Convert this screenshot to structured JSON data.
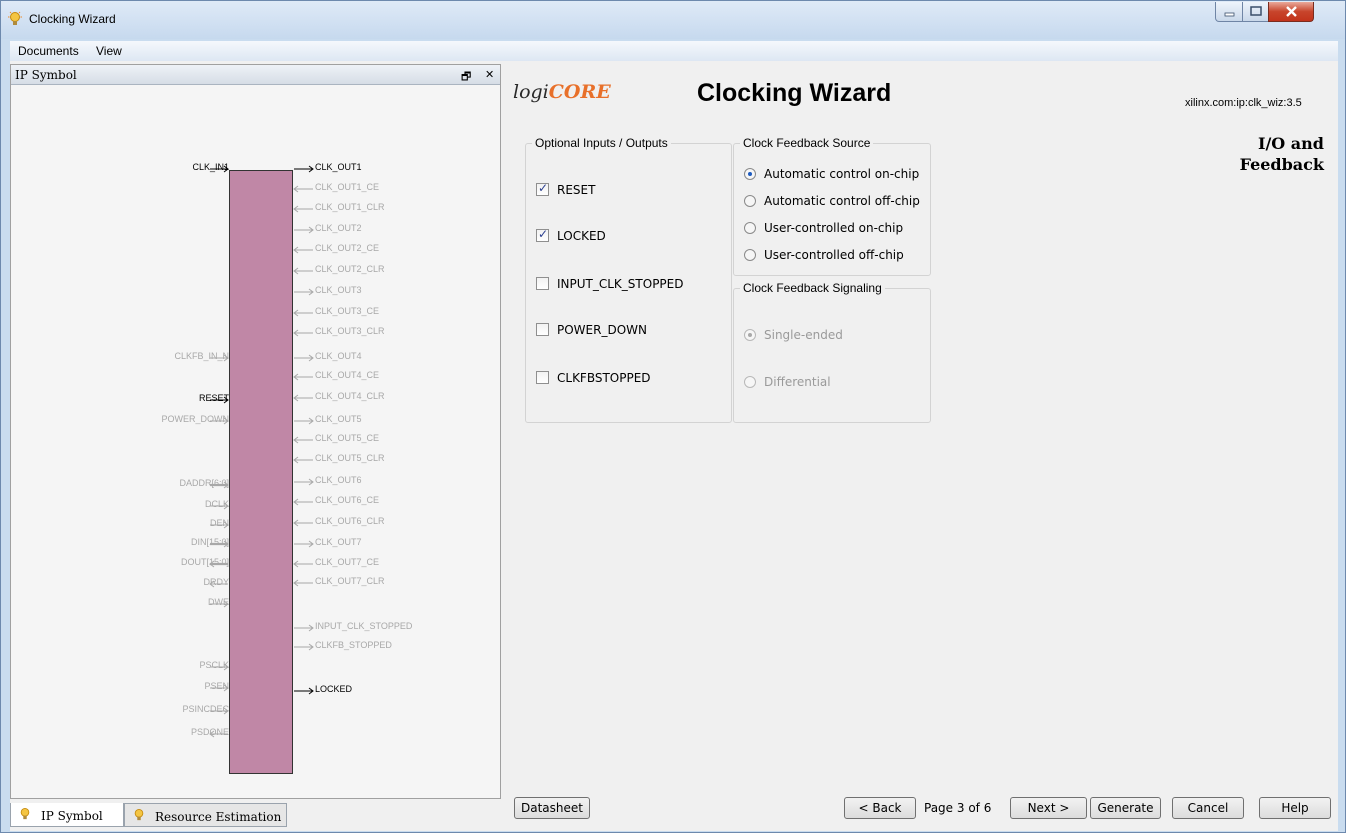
{
  "window": {
    "title": "Clocking Wizard",
    "icon": "lightbulb-icon"
  },
  "menu": [
    "Documents",
    "View"
  ],
  "left_panel": {
    "title": "IP Symbol",
    "float_icon": "restore-icon",
    "close_icon": "close-icon",
    "left_pins": [
      {
        "label": "CLK_IN1",
        "active": true
      },
      {
        "label": "CLKFB_IN_N",
        "active": false
      },
      {
        "label": "RESET",
        "active": true
      },
      {
        "label": "POWER_DOWN",
        "active": false
      },
      {
        "label": "DADDR[6:0]",
        "active": false
      },
      {
        "label": "DCLK",
        "active": false
      },
      {
        "label": "DEN",
        "active": false
      },
      {
        "label": "DIN[15:0]",
        "active": false
      },
      {
        "label": "DOUT[15:0]",
        "active": false
      },
      {
        "label": "DRDY",
        "active": false
      },
      {
        "label": "DWE",
        "active": false
      },
      {
        "label": "PSCLK",
        "active": false
      },
      {
        "label": "PSEN",
        "active": false
      },
      {
        "label": "PSINCDEC",
        "active": false
      },
      {
        "label": "PSDONE",
        "active": false
      }
    ],
    "right_pins": [
      {
        "label": "CLK_OUT1",
        "active": true
      },
      {
        "label": "CLK_OUT1_CE",
        "active": false
      },
      {
        "label": "CLK_OUT1_CLR",
        "active": false
      },
      {
        "label": "CLK_OUT2",
        "active": false
      },
      {
        "label": "CLK_OUT2_CE",
        "active": false
      },
      {
        "label": "CLK_OUT2_CLR",
        "active": false
      },
      {
        "label": "CLK_OUT3",
        "active": false
      },
      {
        "label": "CLK_OUT3_CE",
        "active": false
      },
      {
        "label": "CLK_OUT3_CLR",
        "active": false
      },
      {
        "label": "CLK_OUT4",
        "active": false
      },
      {
        "label": "CLK_OUT4_CE",
        "active": false
      },
      {
        "label": "CLK_OUT4_CLR",
        "active": false
      },
      {
        "label": "CLK_OUT5",
        "active": false
      },
      {
        "label": "CLK_OUT5_CE",
        "active": false
      },
      {
        "label": "CLK_OUT5_CLR",
        "active": false
      },
      {
        "label": "CLK_OUT6",
        "active": false
      },
      {
        "label": "CLK_OUT6_CE",
        "active": false
      },
      {
        "label": "CLK_OUT6_CLR",
        "active": false
      },
      {
        "label": "CLK_OUT7",
        "active": false
      },
      {
        "label": "CLK_OUT7_CE",
        "active": false
      },
      {
        "label": "CLK_OUT7_CLR",
        "active": false
      },
      {
        "label": "INPUT_CLK_STOPPED",
        "active": false
      },
      {
        "label": "CLKFB_STOPPED",
        "active": false
      },
      {
        "label": "LOCKED",
        "active": true
      }
    ],
    "tabs": [
      {
        "label": "IP Symbol",
        "active": true
      },
      {
        "label": "Resource Estimation",
        "active": false
      }
    ]
  },
  "header": {
    "logo_prefix": "logi",
    "logo_core": "CORE",
    "title": "Clocking Wizard",
    "ip_id": "xilinx.com:ip:clk_wiz:3.5",
    "page_title_line1": "I/O and",
    "page_title_line2": "Feedback"
  },
  "optional_io": {
    "title": "Optional Inputs / Outputs",
    "items": [
      {
        "label": "RESET",
        "checked": true
      },
      {
        "label": "LOCKED",
        "checked": true
      },
      {
        "label": "INPUT_CLK_STOPPED",
        "checked": false
      },
      {
        "label": "POWER_DOWN",
        "checked": false
      },
      {
        "label": "CLKFBSTOPPED",
        "checked": false
      }
    ]
  },
  "feedback_source": {
    "title": "Clock Feedback Source",
    "options": [
      {
        "label": "Automatic control on-chip",
        "selected": true
      },
      {
        "label": "Automatic control off-chip",
        "selected": false
      },
      {
        "label": "User-controlled on-chip",
        "selected": false
      },
      {
        "label": "User-controlled off-chip",
        "selected": false
      }
    ]
  },
  "feedback_signaling": {
    "title": "Clock Feedback Signaling",
    "options": [
      {
        "label": "Single-ended",
        "selected": true,
        "disabled": true
      },
      {
        "label": "Differential",
        "selected": false,
        "disabled": true
      }
    ]
  },
  "footer": {
    "datasheet": "Datasheet",
    "back": "< Back",
    "page": "Page 3 of 6",
    "next": "Next >",
    "generate": "Generate",
    "cancel": "Cancel",
    "help": "Help"
  }
}
